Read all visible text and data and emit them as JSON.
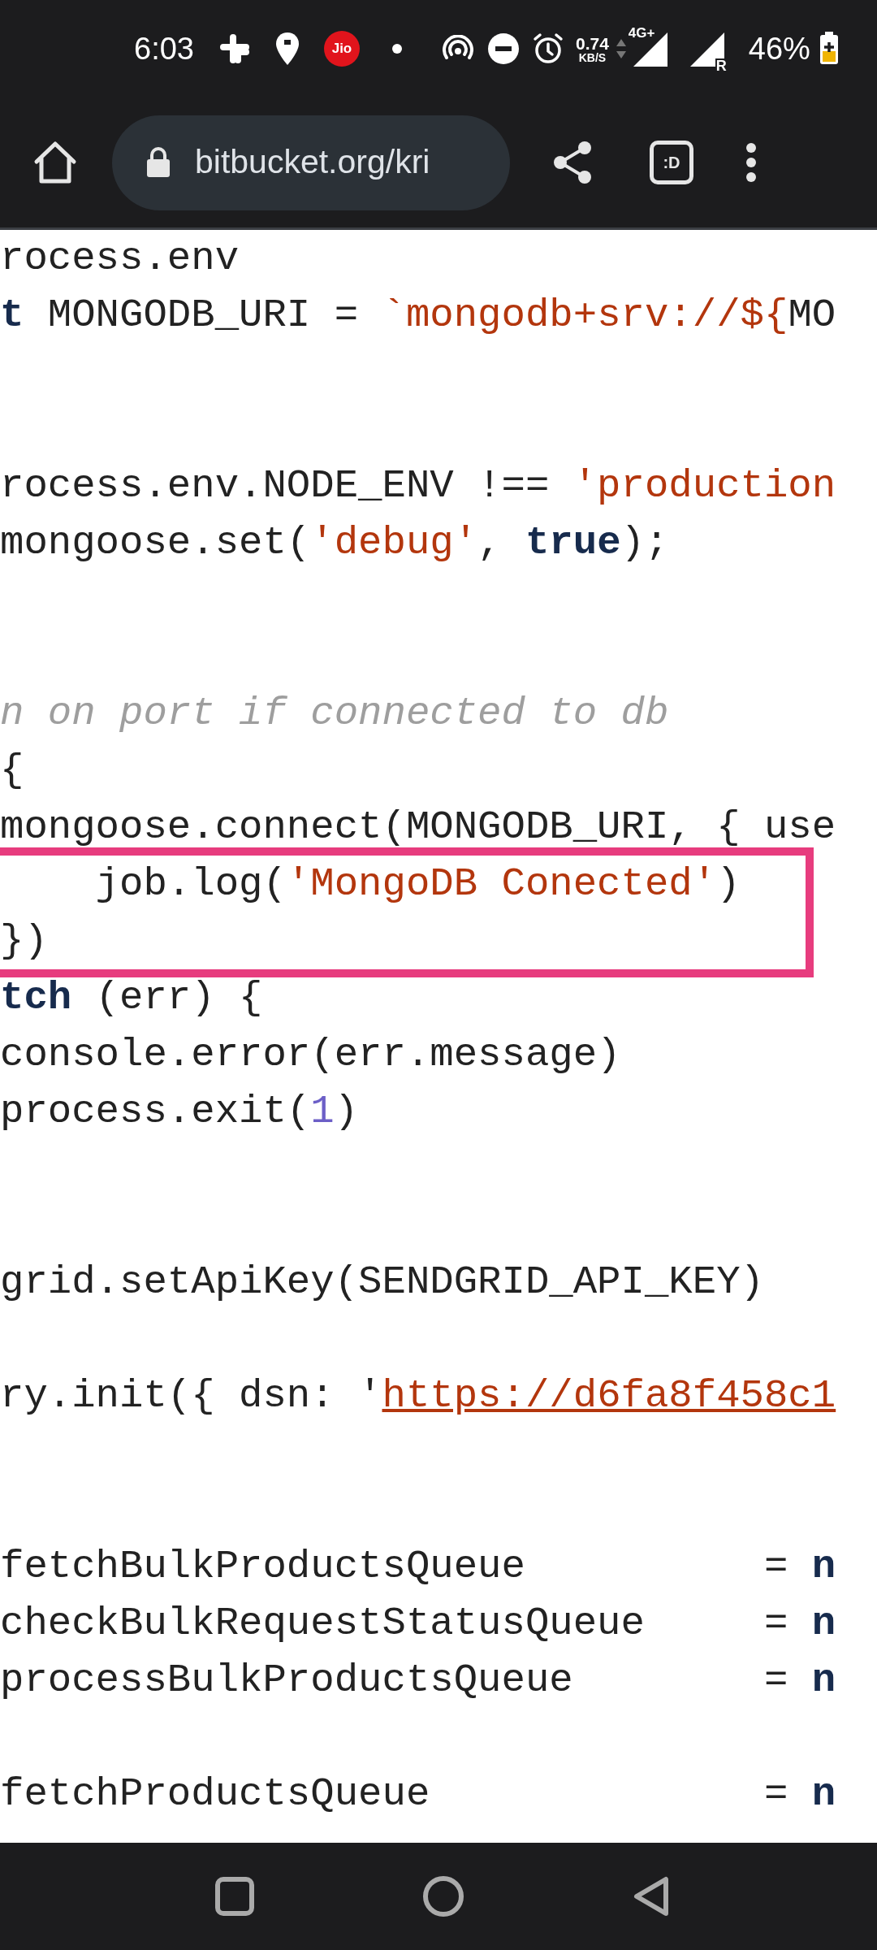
{
  "status_bar": {
    "time": "6:03",
    "carrier_badge": "Jio",
    "net_speed": "0.74",
    "net_speed_unit": "KB/S",
    "network_type": "4G+",
    "roaming": "R",
    "battery": "46%"
  },
  "browser_toolbar": {
    "url": "bitbucket.org/kri",
    "tab_switcher": ":D"
  },
  "code": {
    "lines": [
      {
        "kind": "code",
        "highlighted": false,
        "tokens": [
          {
            "kind": "plain",
            "text": "rocess.env"
          }
        ]
      },
      {
        "kind": "code",
        "highlighted": false,
        "tokens": [
          {
            "kind": "keyword",
            "text": "t"
          },
          {
            "kind": "plain",
            "text": " MONGODB_URI = "
          },
          {
            "kind": "string",
            "text": "`mongodb+srv://${"
          },
          {
            "kind": "plain",
            "text": "MO"
          }
        ]
      },
      {
        "kind": "blank",
        "highlighted": false
      },
      {
        "kind": "blank",
        "highlighted": false
      },
      {
        "kind": "code",
        "highlighted": false,
        "tokens": [
          {
            "kind": "plain",
            "text": "rocess.env.NODE_ENV !== "
          },
          {
            "kind": "string",
            "text": "'production"
          }
        ]
      },
      {
        "kind": "code",
        "highlighted": false,
        "tokens": [
          {
            "kind": "plain",
            "text": "mongoose.set("
          },
          {
            "kind": "string",
            "text": "'debug'"
          },
          {
            "kind": "plain",
            "text": ", "
          },
          {
            "kind": "keyword",
            "text": "true"
          },
          {
            "kind": "plain",
            "text": ");"
          }
        ]
      },
      {
        "kind": "blank",
        "highlighted": false
      },
      {
        "kind": "blank",
        "highlighted": false
      },
      {
        "kind": "code",
        "highlighted": false,
        "tokens": [
          {
            "kind": "comment",
            "text": "n on port if connected to db"
          }
        ]
      },
      {
        "kind": "code",
        "highlighted": false,
        "tokens": [
          {
            "kind": "plain",
            "text": "{"
          }
        ]
      },
      {
        "kind": "code",
        "highlighted": false,
        "tokens": [
          {
            "kind": "plain",
            "text": "mongoose.connect(MONGODB_URI, { use"
          }
        ]
      },
      {
        "kind": "code",
        "highlighted": true,
        "tokens": [
          {
            "kind": "plain",
            "text": "    job.log("
          },
          {
            "kind": "string",
            "text": "'MongoDB Conected'"
          },
          {
            "kind": "plain",
            "text": ")"
          }
        ]
      },
      {
        "kind": "code",
        "highlighted": true,
        "tokens": [
          {
            "kind": "plain",
            "text": "})"
          }
        ]
      },
      {
        "kind": "code",
        "highlighted": false,
        "tokens": [
          {
            "kind": "keyword",
            "text": "tch"
          },
          {
            "kind": "plain",
            "text": " (err) {"
          }
        ]
      },
      {
        "kind": "code",
        "highlighted": false,
        "tokens": [
          {
            "kind": "plain",
            "text": "console.error(err.message)"
          }
        ]
      },
      {
        "kind": "code",
        "highlighted": false,
        "tokens": [
          {
            "kind": "plain",
            "text": "process.exit("
          },
          {
            "kind": "number",
            "text": "1"
          },
          {
            "kind": "plain",
            "text": ")"
          }
        ]
      },
      {
        "kind": "blank",
        "highlighted": false
      },
      {
        "kind": "blank",
        "highlighted": false
      },
      {
        "kind": "code",
        "highlighted": false,
        "tokens": [
          {
            "kind": "plain",
            "text": "grid.setApiKey(SENDGRID_API_KEY)"
          }
        ]
      },
      {
        "kind": "blank",
        "highlighted": false
      },
      {
        "kind": "code",
        "highlighted": false,
        "tokens": [
          {
            "kind": "plain",
            "text": "ry.init({ dsn: '"
          },
          {
            "kind": "link",
            "text": "https://d6fa8f458c1"
          }
        ]
      },
      {
        "kind": "blank",
        "highlighted": false
      },
      {
        "kind": "blank",
        "highlighted": false
      },
      {
        "kind": "code",
        "highlighted": false,
        "tokens": [
          {
            "kind": "plain",
            "text": "fetchBulkProductsQueue          = "
          },
          {
            "kind": "keyword",
            "text": "n"
          }
        ]
      },
      {
        "kind": "code",
        "highlighted": false,
        "tokens": [
          {
            "kind": "plain",
            "text": "checkBulkRequestStatusQueue     = "
          },
          {
            "kind": "keyword",
            "text": "n"
          }
        ]
      },
      {
        "kind": "code",
        "highlighted": false,
        "tokens": [
          {
            "kind": "plain",
            "text": "processBulkProductsQueue        = "
          },
          {
            "kind": "keyword",
            "text": "n"
          }
        ]
      },
      {
        "kind": "blank",
        "highlighted": false
      },
      {
        "kind": "code",
        "highlighted": false,
        "tokens": [
          {
            "kind": "plain",
            "text": "fetchProductsQueue              = "
          },
          {
            "kind": "keyword",
            "text": "n"
          }
        ]
      }
    ]
  }
}
